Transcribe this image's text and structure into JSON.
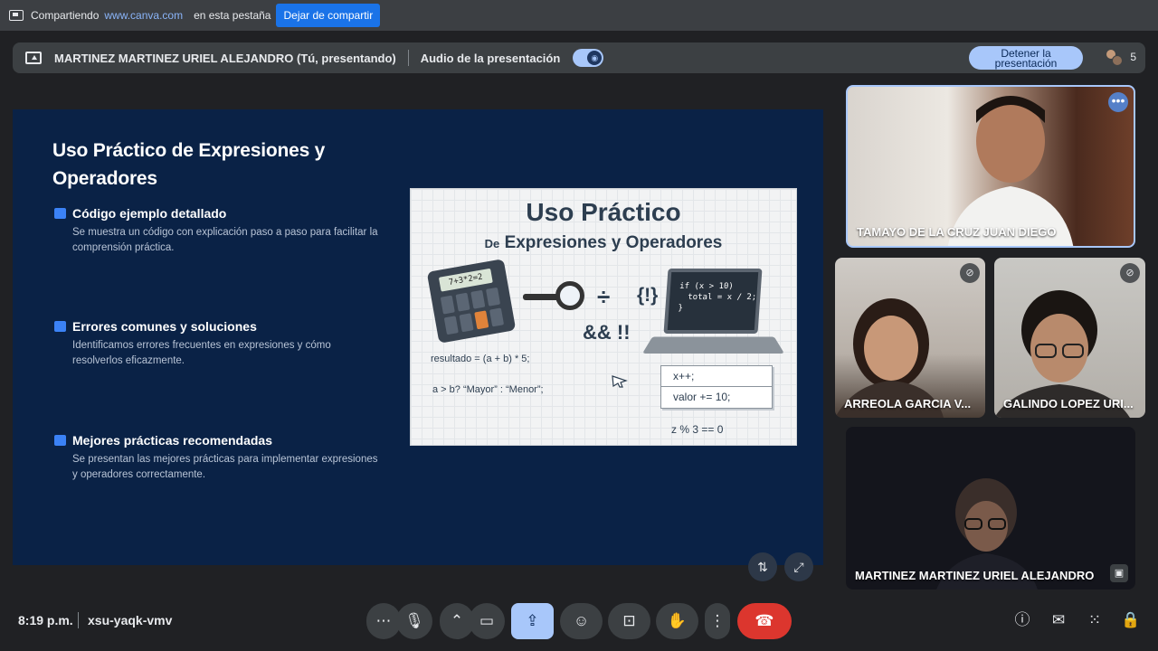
{
  "share_bar": {
    "sharing_label": "Compartiendo",
    "site": "www.canva.com",
    "tab_label": "en esta pestaña",
    "stop_sharing": "Dejar de compartir"
  },
  "presenting_bar": {
    "presenter": "MARTINEZ MARTINEZ URIEL ALEJANDRO (Tú, presentando)",
    "audio_label": "Audio de la presentación",
    "audio_enabled": true,
    "stop_presenting": "Detener la presentación",
    "participant_count": "5"
  },
  "slide": {
    "title": "Uso Práctico de Expresiones y Operadores",
    "sections": [
      {
        "icon": "envelope-icon",
        "heading": "Código ejemplo detallado",
        "text": "Se muestra un código con explicación paso a paso para facilitar la comprensión práctica."
      },
      {
        "icon": "checkbox-icon",
        "heading": "Errores comunes y soluciones",
        "text": "Identificamos errores frecuentes en expresiones y cómo resolverlos eficazmente."
      },
      {
        "icon": "flag-icon",
        "heading": "Mejores prácticas recomendadas",
        "text": "Se presentan las mejores prácticas para implementar expresiones y operadores correctamente."
      }
    ],
    "illustration": {
      "title": "Uso Práctico",
      "subtitle_prefix": "De",
      "subtitle": "Expresiones y Operadores",
      "calc_display": "7+3*2=2",
      "braces": "{!}",
      "logic_ops": "&& !!",
      "laptop_code": [
        "if (x > 10)",
        "total = x / 2;",
        "}"
      ],
      "line_result": "resultado = (a + b) * 5;",
      "line_ternary": "a > b? “Mayor” : “Menor”;",
      "box_lines": [
        "x++;",
        "valor += 10;"
      ],
      "line_mod": "z % 3 == 0"
    }
  },
  "participants": [
    {
      "name": "TAMAYO DE LA CRUZ JUAN DIEGO",
      "muted": false,
      "speaking": true
    },
    {
      "name": "ARREOLA GARCIA V...",
      "muted": true
    },
    {
      "name": "GALINDO LOPEZ URI...",
      "muted": true
    },
    {
      "name": "MARTINEZ MARTINEZ URIEL ALEJANDRO",
      "muted": false
    }
  ],
  "bottom_bar": {
    "time": "8:19 p.m.",
    "meeting_code": "xsu-yaqk-vmv"
  },
  "colors": {
    "accent": "#a8c7fa",
    "end_call": "#dc362e",
    "slide_bg": "#0a2246"
  }
}
